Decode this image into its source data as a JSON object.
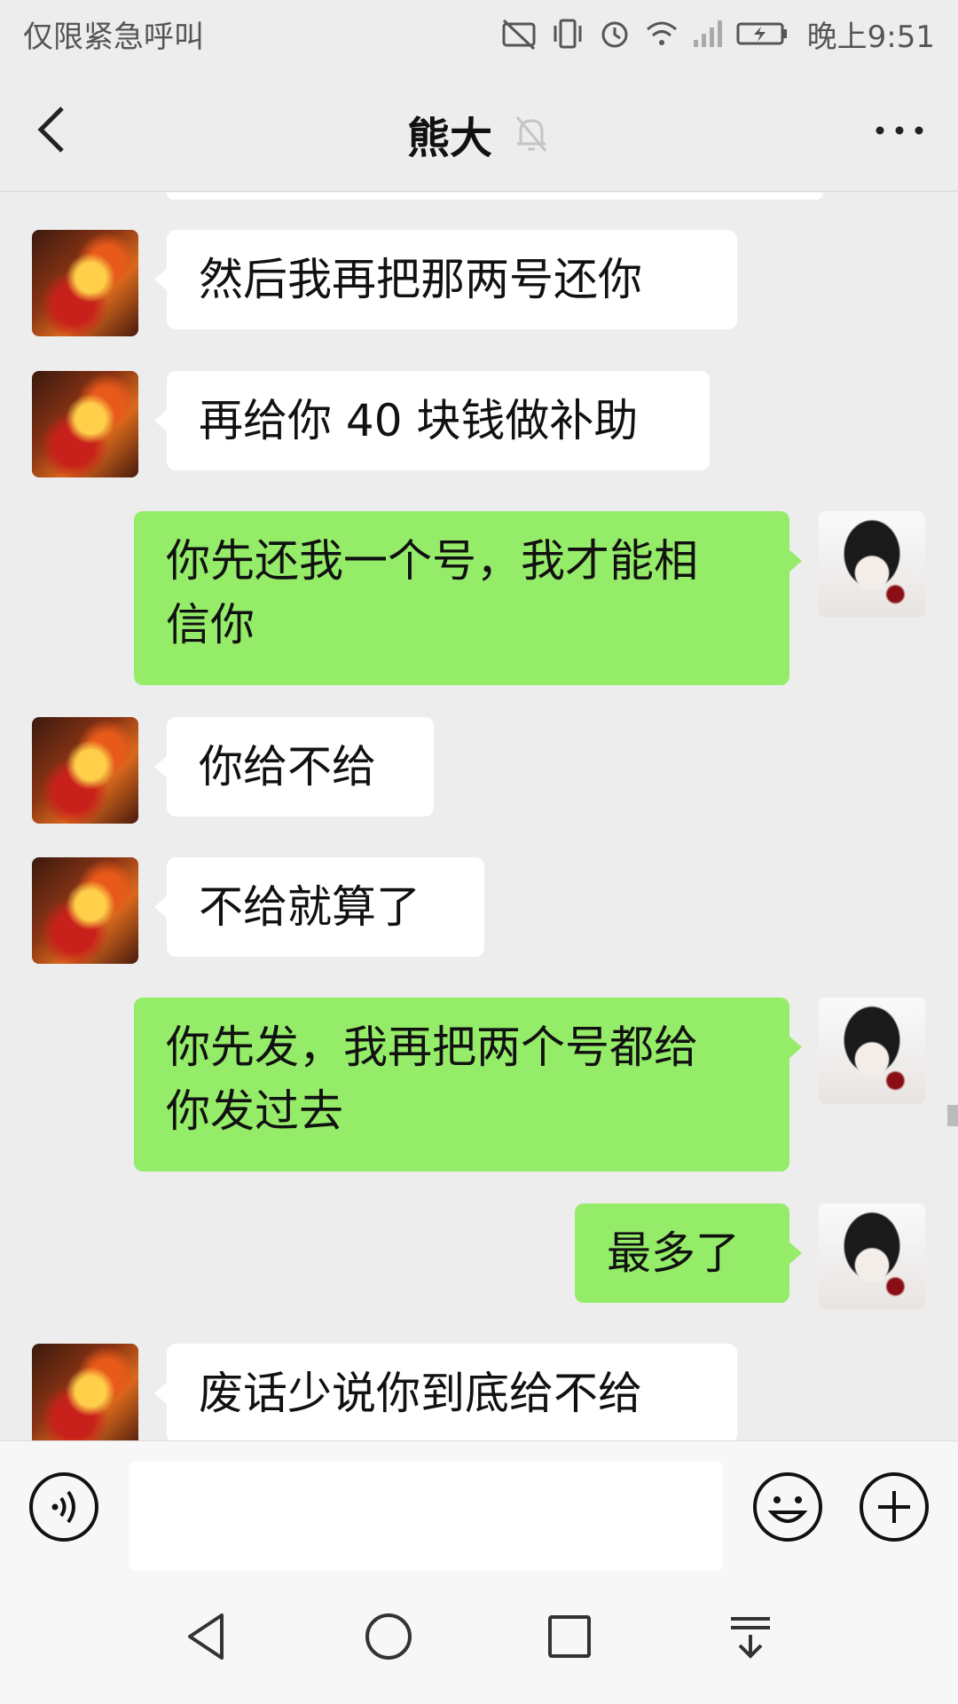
{
  "status_bar": {
    "left_text": "仅限紧急呼叫",
    "time": "晚上9:51",
    "icons": [
      "no-sim-icon",
      "vibrate-icon",
      "alarm-icon",
      "wifi-icon",
      "signal-icon",
      "battery-charging-icon"
    ]
  },
  "header": {
    "title": "熊大",
    "muted": true,
    "back_icon": "chevron-left-icon",
    "more_icon": "more-dots-icon"
  },
  "messages": [
    {
      "from": "other",
      "text": "然后我再把那两号还你"
    },
    {
      "from": "other",
      "text": "再给你 40 块钱做补助"
    },
    {
      "from": "self",
      "lines": [
        "你先还我一个号，我才能相",
        "信你"
      ]
    },
    {
      "from": "other",
      "text": "你给不给"
    },
    {
      "from": "other",
      "text": "不给就算了"
    },
    {
      "from": "self",
      "lines": [
        "你先发，我再把两个号都给",
        "你发过去"
      ]
    },
    {
      "from": "self",
      "text": "最多了"
    },
    {
      "from": "other",
      "text": "废话少说你到底给不给"
    }
  ],
  "input_bar": {
    "voice_icon": "voice-icon",
    "emoji_icon": "emoji-icon",
    "plus_icon": "plus-icon",
    "input_value": ""
  },
  "colors": {
    "background": "#ededed",
    "self_bubble": "#95ec69",
    "other_bubble": "#ffffff"
  },
  "nav_bar": {
    "icons": [
      "nav-back-icon",
      "nav-home-icon",
      "nav-recents-icon",
      "nav-notification-icon"
    ]
  }
}
